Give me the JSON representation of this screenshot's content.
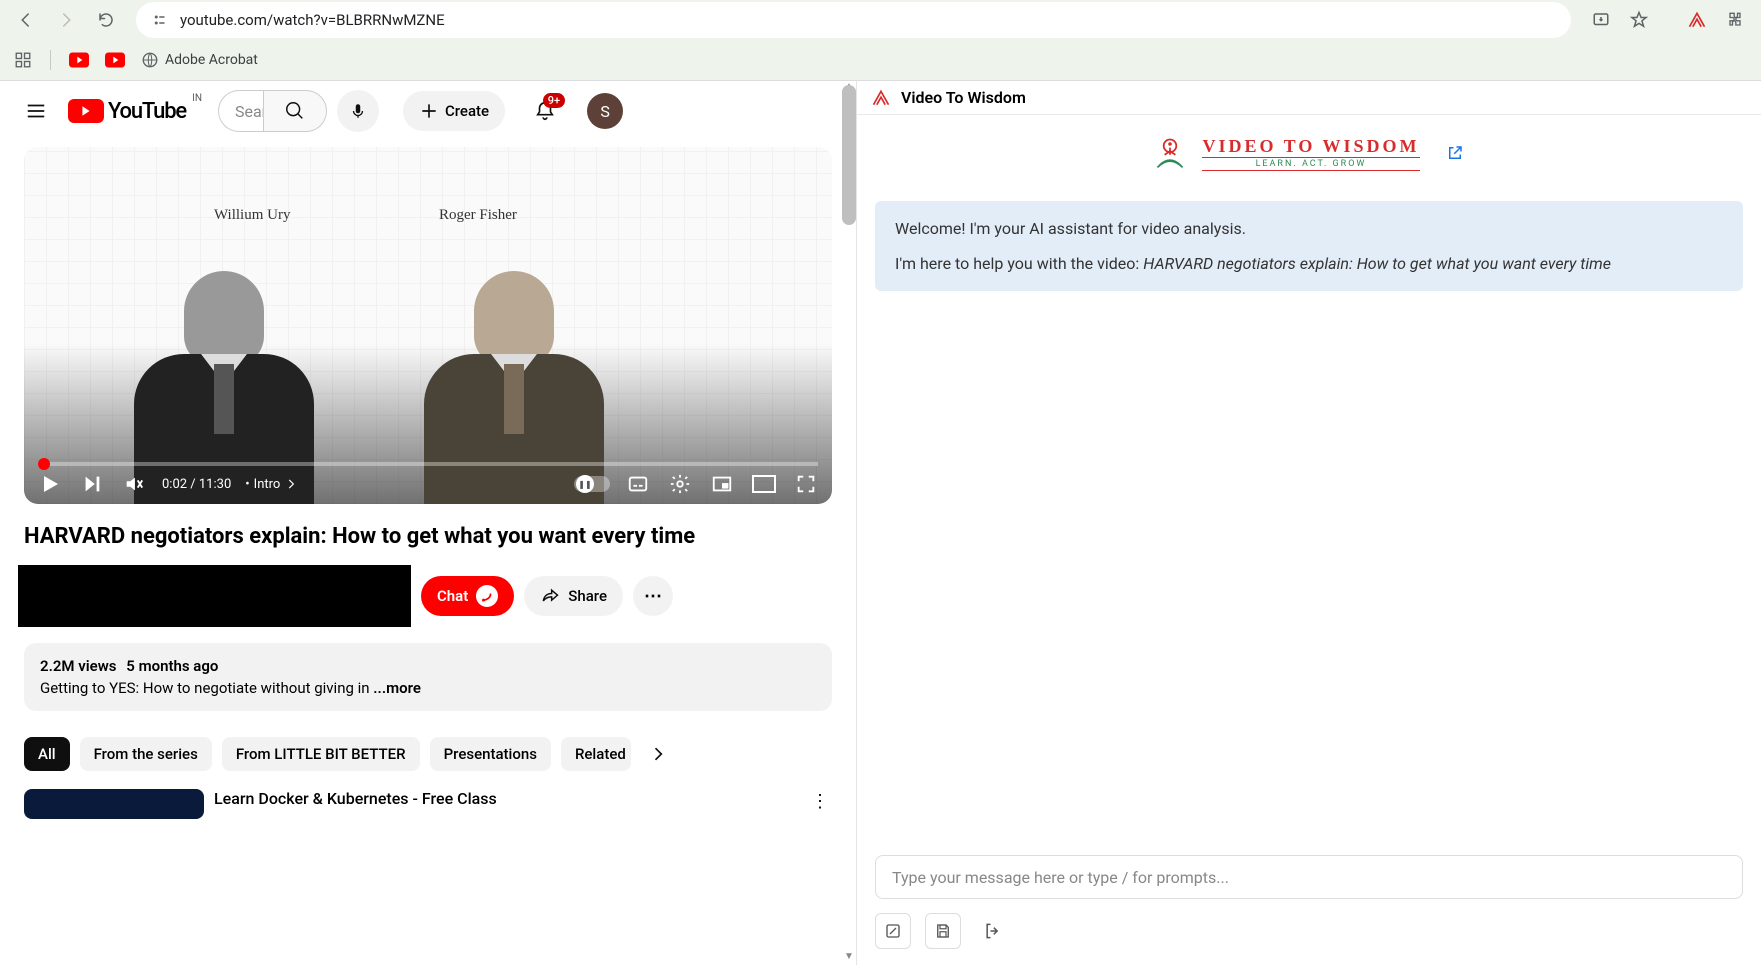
{
  "browser": {
    "url": "youtube.com/watch?v=BLBRRNwMZNE",
    "bookmarks": {
      "adobe": "Adobe Acrobat"
    }
  },
  "yt": {
    "logo_cc": "IN",
    "search_placeholder": "Search",
    "create": "Create",
    "notif_badge": "9+",
    "avatar_letter": "S"
  },
  "player": {
    "ann1": "Willium Ury",
    "ann2": "Roger Fisher",
    "time": "0:02 / 11:30",
    "chapter_sep": "•",
    "chapter": "Intro"
  },
  "video": {
    "title": "HARVARD negotiators explain: How to get what you want every time",
    "chat": "Chat",
    "share": "Share",
    "views": "2.2M views",
    "age": "5 months ago",
    "desc": "Getting to YES: How to negotiate without giving in ",
    "more": "...more"
  },
  "chips": [
    "All",
    "From the series",
    "From LITTLE BIT BETTER",
    "Presentations",
    "Related"
  ],
  "rec": {
    "title": "Learn Docker & Kubernetes - Free Class"
  },
  "ext": {
    "header": "Video To Wisdom",
    "hero_main": "VIDEO TO WISDOM",
    "hero_sub": "LEARN. ACT. GROW",
    "welcome1": "Welcome! I'm your AI assistant for video analysis.",
    "welcome2a": "I'm here to help you with the video: ",
    "welcome2b": "HARVARD negotiators explain: How to get what you want every time",
    "input_placeholder": "Type your message here or type / for prompts..."
  }
}
